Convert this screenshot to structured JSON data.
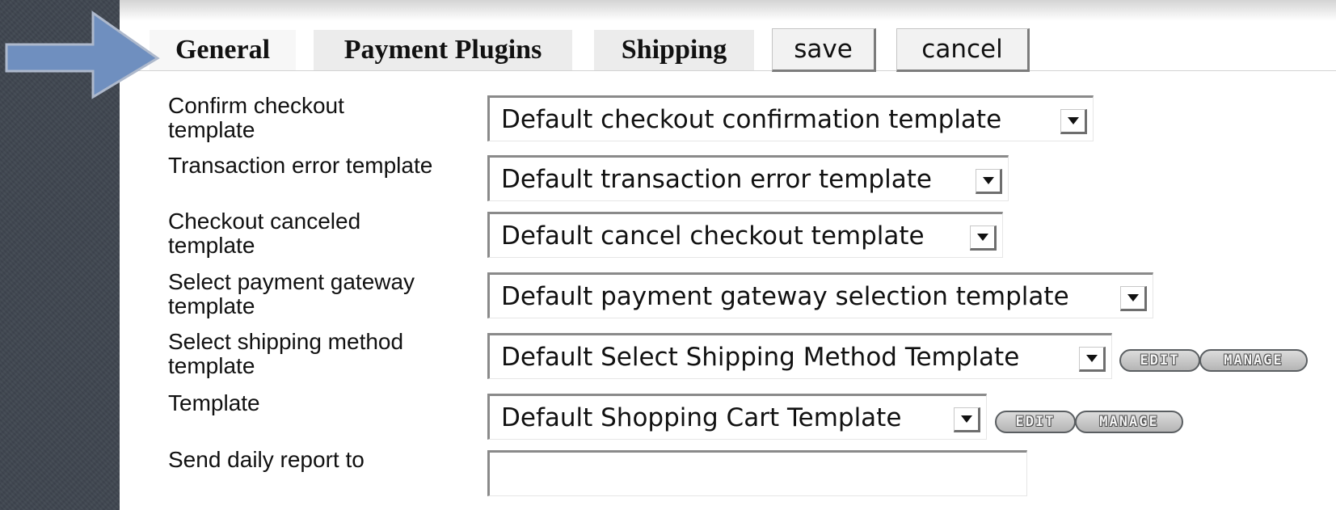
{
  "tabs": [
    {
      "label": "General",
      "active": true
    },
    {
      "label": "Payment Plugins",
      "active": false
    },
    {
      "label": "Shipping",
      "active": false
    }
  ],
  "buttons": {
    "save": "save",
    "cancel": "cancel"
  },
  "fields": [
    {
      "label": "Confirm checkout template",
      "value": "Default checkout confirmation template"
    },
    {
      "label": "Transaction error template",
      "value": "Default transaction error template"
    },
    {
      "label": "Checkout canceled template",
      "value": "Default cancel checkout template"
    },
    {
      "label": "Select payment gateway template",
      "value": "Default payment gateway selection template"
    },
    {
      "label": "Select shipping method template",
      "value": "Default Select Shipping Method Template"
    },
    {
      "label": "Template",
      "value": "Default Shopping Cart Template"
    },
    {
      "label": "Send daily report to",
      "value": ""
    }
  ],
  "actions": {
    "edit": "EDIT",
    "manage": "MANAGE"
  },
  "colors": {
    "arrow": "#6f8fbf",
    "background": "#3f4650",
    "panel": "#ffffff"
  }
}
